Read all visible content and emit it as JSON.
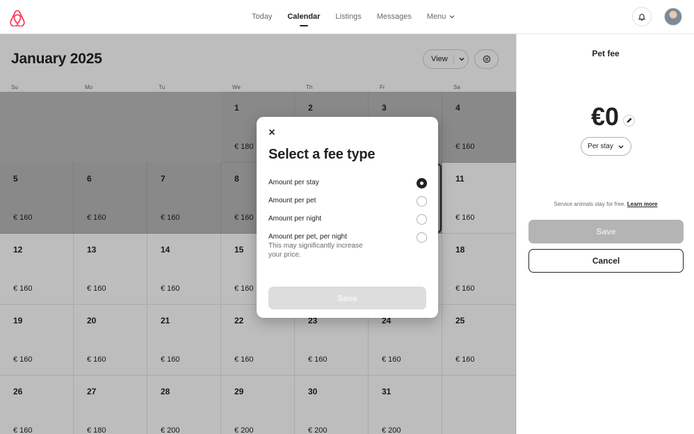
{
  "nav": {
    "items": [
      {
        "label": "Today",
        "active": false
      },
      {
        "label": "Calendar",
        "active": true
      },
      {
        "label": "Listings",
        "active": false
      },
      {
        "label": "Messages",
        "active": false
      }
    ],
    "menu_label": "Menu",
    "logo_icon": "airbnb-logo-icon",
    "brand_color": "#ff385c"
  },
  "calendar": {
    "month_title": "January 2025",
    "view_label": "View",
    "weekdays": [
      "Su",
      "Mo",
      "Tu",
      "We",
      "Th",
      "Fr",
      "Sa"
    ],
    "weeks": [
      [
        {
          "day": "",
          "price": "",
          "state": "blank"
        },
        {
          "day": "",
          "price": "",
          "state": "blank"
        },
        {
          "day": "",
          "price": "",
          "state": "blank"
        },
        {
          "day": "1",
          "price": "€ 180",
          "state": "past"
        },
        {
          "day": "2",
          "price": "",
          "state": "past"
        },
        {
          "day": "3",
          "price": "",
          "state": "past"
        },
        {
          "day": "4",
          "price": "€ 160",
          "state": "past"
        }
      ],
      [
        {
          "day": "5",
          "price": "€ 160",
          "state": "past"
        },
        {
          "day": "6",
          "price": "€ 160",
          "state": "past"
        },
        {
          "day": "7",
          "price": "€ 160",
          "state": "past"
        },
        {
          "day": "8",
          "price": "€ 160",
          "state": "past"
        },
        {
          "day": "",
          "price": "",
          "state": "past"
        },
        {
          "day": "",
          "price": "",
          "state": "past"
        },
        {
          "day": "11",
          "price": "€ 160",
          "state": "open"
        }
      ],
      [
        {
          "day": "12",
          "price": "€ 160",
          "state": "open"
        },
        {
          "day": "13",
          "price": "€ 160",
          "state": "open"
        },
        {
          "day": "14",
          "price": "€ 160",
          "state": "open"
        },
        {
          "day": "15",
          "price": "€ 160",
          "state": "open"
        },
        {
          "day": "",
          "price": "",
          "state": "open"
        },
        {
          "day": "",
          "price": "",
          "state": "open"
        },
        {
          "day": "18",
          "price": "€ 160",
          "state": "open"
        }
      ],
      [
        {
          "day": "19",
          "price": "€ 160",
          "state": "open"
        },
        {
          "day": "20",
          "price": "€ 160",
          "state": "open"
        },
        {
          "day": "21",
          "price": "€ 160",
          "state": "open"
        },
        {
          "day": "22",
          "price": "€ 160",
          "state": "open"
        },
        {
          "day": "23",
          "price": "€ 160",
          "state": "open"
        },
        {
          "day": "24",
          "price": "€ 160",
          "state": "open"
        },
        {
          "day": "25",
          "price": "€ 160",
          "state": "open"
        }
      ],
      [
        {
          "day": "26",
          "price": "€ 160",
          "state": "open"
        },
        {
          "day": "27",
          "price": "€ 180",
          "state": "open"
        },
        {
          "day": "28",
          "price": "€ 200",
          "state": "open"
        },
        {
          "day": "29",
          "price": "€ 200",
          "state": "open"
        },
        {
          "day": "30",
          "price": "€ 200",
          "state": "open"
        },
        {
          "day": "31",
          "price": "€ 200",
          "state": "open"
        },
        {
          "day": "",
          "price": "",
          "state": "open"
        }
      ]
    ]
  },
  "pane": {
    "title": "Pet fee",
    "amount": "€0",
    "per_stay_label": "Per stay",
    "service_note": "Service animals stay for free.",
    "learn_more": "Learn more",
    "save_label": "Save",
    "cancel_label": "Cancel"
  },
  "modal": {
    "title": "Select a fee type",
    "options": [
      {
        "label": "Amount per stay",
        "desc": "",
        "checked": true
      },
      {
        "label": "Amount per pet",
        "desc": "",
        "checked": false
      },
      {
        "label": "Amount per night",
        "desc": "",
        "checked": false
      },
      {
        "label": "Amount per pet, per night",
        "desc": "This may significantly increase your price.",
        "checked": false
      }
    ],
    "save_label": "Save"
  }
}
